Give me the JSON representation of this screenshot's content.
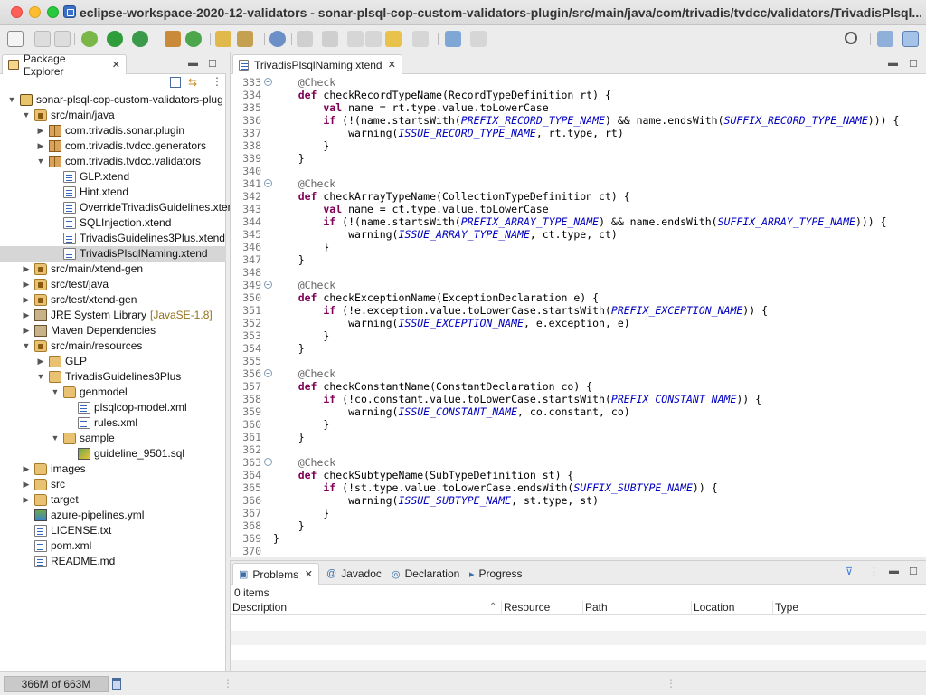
{
  "window": {
    "title": "eclipse-workspace-2020-12-validators - sonar-plsql-cop-custom-validators-plugin/src/main/java/com/trivadis/tvdcc/validators/TrivadisPlsql..."
  },
  "package_explorer": {
    "tab_label": "Package Explorer",
    "tree": [
      {
        "label": "sonar-plsql-cop-custom-validators-plug",
        "depth": 0,
        "arrow": "down",
        "icon": "project"
      },
      {
        "label": "src/main/java",
        "depth": 1,
        "arrow": "down",
        "icon": "source-folder"
      },
      {
        "label": "com.trivadis.sonar.plugin",
        "depth": 2,
        "arrow": "right",
        "icon": "package"
      },
      {
        "label": "com.trivadis.tvdcc.generators",
        "depth": 2,
        "arrow": "right",
        "icon": "package"
      },
      {
        "label": "com.trivadis.tvdcc.validators",
        "depth": 2,
        "arrow": "down",
        "icon": "package"
      },
      {
        "label": "GLP.xtend",
        "depth": 3,
        "arrow": "",
        "icon": "file"
      },
      {
        "label": "Hint.xtend",
        "depth": 3,
        "arrow": "",
        "icon": "file"
      },
      {
        "label": "OverrideTrivadisGuidelines.xtend",
        "depth": 3,
        "arrow": "",
        "icon": "file"
      },
      {
        "label": "SQLInjection.xtend",
        "depth": 3,
        "arrow": "",
        "icon": "file"
      },
      {
        "label": "TrivadisGuidelines3Plus.xtend",
        "depth": 3,
        "arrow": "",
        "icon": "file"
      },
      {
        "label": "TrivadisPlsqlNaming.xtend",
        "depth": 3,
        "arrow": "",
        "icon": "file",
        "selected": true
      },
      {
        "label": "src/main/xtend-gen",
        "depth": 1,
        "arrow": "right",
        "icon": "source-folder"
      },
      {
        "label": "src/test/java",
        "depth": 1,
        "arrow": "right",
        "icon": "source-folder"
      },
      {
        "label": "src/test/xtend-gen",
        "depth": 1,
        "arrow": "right",
        "icon": "source-folder"
      },
      {
        "label": "JRE System Library",
        "decoration": "[JavaSE-1.8]",
        "depth": 1,
        "arrow": "right",
        "icon": "library"
      },
      {
        "label": "Maven Dependencies",
        "depth": 1,
        "arrow": "right",
        "icon": "library"
      },
      {
        "label": "src/main/resources",
        "depth": 1,
        "arrow": "down",
        "icon": "source-folder"
      },
      {
        "label": "GLP",
        "depth": 2,
        "arrow": "right",
        "icon": "folder"
      },
      {
        "label": "TrivadisGuidelines3Plus",
        "depth": 2,
        "arrow": "down",
        "icon": "folder"
      },
      {
        "label": "genmodel",
        "depth": 3,
        "arrow": "down",
        "icon": "folder"
      },
      {
        "label": "plsqlcop-model.xml",
        "depth": 4,
        "arrow": "",
        "icon": "file"
      },
      {
        "label": "rules.xml",
        "depth": 4,
        "arrow": "",
        "icon": "file"
      },
      {
        "label": "sample",
        "depth": 3,
        "arrow": "down",
        "icon": "folder"
      },
      {
        "label": "guideline_9501.sql",
        "depth": 4,
        "arrow": "",
        "icon": "image"
      },
      {
        "label": "images",
        "depth": 1,
        "arrow": "right",
        "icon": "folder"
      },
      {
        "label": "src",
        "depth": 1,
        "arrow": "right",
        "icon": "folder"
      },
      {
        "label": "target",
        "depth": 1,
        "arrow": "right",
        "icon": "folder"
      },
      {
        "label": "azure-pipelines.yml",
        "depth": 1,
        "arrow": "",
        "icon": "yml"
      },
      {
        "label": "LICENSE.txt",
        "depth": 1,
        "arrow": "",
        "icon": "file"
      },
      {
        "label": "pom.xml",
        "depth": 1,
        "arrow": "",
        "icon": "file"
      },
      {
        "label": "README.md",
        "depth": 1,
        "arrow": "",
        "icon": "file"
      }
    ]
  },
  "editor": {
    "tab_label": "TrivadisPlsqlNaming.xtend",
    "lines": [
      {
        "n": "333",
        "fold": true,
        "tokens": [
          [
            "an",
            "    @Check"
          ]
        ]
      },
      {
        "n": "334",
        "tokens": [
          [
            "kw",
            "    def "
          ],
          [
            "",
            "checkRecordTypeName(RecordTypeDefinition rt) {"
          ]
        ]
      },
      {
        "n": "335",
        "tokens": [
          [
            "kw",
            "        val "
          ],
          [
            "",
            "name = rt.type.value.toLowerCase"
          ]
        ]
      },
      {
        "n": "336",
        "tokens": [
          [
            "kw",
            "        if "
          ],
          [
            "",
            "(!(name.startsWith("
          ],
          [
            "cn",
            "PREFIX_RECORD_TYPE_NAME"
          ],
          [
            "",
            ") && name.endsWith("
          ],
          [
            "cn",
            "SUFFIX_RECORD_TYPE_NAME"
          ],
          [
            "",
            "))) {"
          ]
        ]
      },
      {
        "n": "337",
        "tokens": [
          [
            "",
            "            warning("
          ],
          [
            "cn",
            "ISSUE_RECORD_TYPE_NAME"
          ],
          [
            "",
            ", rt.type, rt)"
          ]
        ]
      },
      {
        "n": "338",
        "tokens": [
          [
            "",
            "        }"
          ]
        ]
      },
      {
        "n": "339",
        "tokens": [
          [
            "",
            "    }"
          ]
        ]
      },
      {
        "n": "340",
        "tokens": []
      },
      {
        "n": "341",
        "fold": true,
        "tokens": [
          [
            "an",
            "    @Check"
          ]
        ]
      },
      {
        "n": "342",
        "tokens": [
          [
            "kw",
            "    def "
          ],
          [
            "",
            "checkArrayTypeName(CollectionTypeDefinition ct) {"
          ]
        ]
      },
      {
        "n": "343",
        "tokens": [
          [
            "kw",
            "        val "
          ],
          [
            "",
            "name = ct.type.value.toLowerCase"
          ]
        ]
      },
      {
        "n": "344",
        "tokens": [
          [
            "kw",
            "        if "
          ],
          [
            "",
            "(!(name.startsWith("
          ],
          [
            "cn",
            "PREFIX_ARRAY_TYPE_NAME"
          ],
          [
            "",
            ") && name.endsWith("
          ],
          [
            "cn",
            "SUFFIX_ARRAY_TYPE_NAME"
          ],
          [
            "",
            "))) {"
          ]
        ]
      },
      {
        "n": "345",
        "tokens": [
          [
            "",
            "            warning("
          ],
          [
            "cn",
            "ISSUE_ARRAY_TYPE_NAME"
          ],
          [
            "",
            ", ct.type, ct)"
          ]
        ]
      },
      {
        "n": "346",
        "tokens": [
          [
            "",
            "        }"
          ]
        ]
      },
      {
        "n": "347",
        "tokens": [
          [
            "",
            "    }"
          ]
        ]
      },
      {
        "n": "348",
        "tokens": []
      },
      {
        "n": "349",
        "fold": true,
        "tokens": [
          [
            "an",
            "    @Check"
          ]
        ]
      },
      {
        "n": "350",
        "tokens": [
          [
            "kw",
            "    def "
          ],
          [
            "",
            "checkExceptionName(ExceptionDeclaration e) {"
          ]
        ]
      },
      {
        "n": "351",
        "tokens": [
          [
            "kw",
            "        if "
          ],
          [
            "",
            "(!e.exception.value.toLowerCase.startsWith("
          ],
          [
            "cn",
            "PREFIX_EXCEPTION_NAME"
          ],
          [
            "",
            ")) {"
          ]
        ]
      },
      {
        "n": "352",
        "tokens": [
          [
            "",
            "            warning("
          ],
          [
            "cn",
            "ISSUE_EXCEPTION_NAME"
          ],
          [
            "",
            ", e.exception, e)"
          ]
        ]
      },
      {
        "n": "353",
        "tokens": [
          [
            "",
            "        }"
          ]
        ]
      },
      {
        "n": "354",
        "tokens": [
          [
            "",
            "    }"
          ]
        ]
      },
      {
        "n": "355",
        "tokens": []
      },
      {
        "n": "356",
        "fold": true,
        "tokens": [
          [
            "an",
            "    @Check"
          ]
        ]
      },
      {
        "n": "357",
        "tokens": [
          [
            "kw",
            "    def "
          ],
          [
            "",
            "checkConstantName(ConstantDeclaration co) {"
          ]
        ]
      },
      {
        "n": "358",
        "tokens": [
          [
            "kw",
            "        if "
          ],
          [
            "",
            "(!co.constant.value.toLowerCase.startsWith("
          ],
          [
            "cn",
            "PREFIX_CONSTANT_NAME"
          ],
          [
            "",
            ")) {"
          ]
        ]
      },
      {
        "n": "359",
        "tokens": [
          [
            "",
            "            warning("
          ],
          [
            "cn",
            "ISSUE_CONSTANT_NAME"
          ],
          [
            "",
            ", co.constant, co)"
          ]
        ]
      },
      {
        "n": "360",
        "tokens": [
          [
            "",
            "        }"
          ]
        ]
      },
      {
        "n": "361",
        "tokens": [
          [
            "",
            "    }"
          ]
        ]
      },
      {
        "n": "362",
        "tokens": []
      },
      {
        "n": "363",
        "fold": true,
        "tokens": [
          [
            "an",
            "    @Check"
          ]
        ]
      },
      {
        "n": "364",
        "tokens": [
          [
            "kw",
            "    def "
          ],
          [
            "",
            "checkSubtypeName(SubTypeDefinition st) {"
          ]
        ]
      },
      {
        "n": "365",
        "tokens": [
          [
            "kw",
            "        if "
          ],
          [
            "",
            "(!st.type.value.toLowerCase.endsWith("
          ],
          [
            "cn",
            "SUFFIX_SUBTYPE_NAME"
          ],
          [
            "",
            ")) {"
          ]
        ]
      },
      {
        "n": "366",
        "tokens": [
          [
            "",
            "            warning("
          ],
          [
            "cn",
            "ISSUE_SUBTYPE_NAME"
          ],
          [
            "",
            ", st.type, st)"
          ]
        ]
      },
      {
        "n": "367",
        "tokens": [
          [
            "",
            "        }"
          ]
        ]
      },
      {
        "n": "368",
        "tokens": [
          [
            "",
            "    }"
          ]
        ]
      },
      {
        "n": "369",
        "tokens": [
          [
            "",
            "}"
          ]
        ]
      },
      {
        "n": "370",
        "tokens": []
      }
    ]
  },
  "bottom_panel": {
    "tabs": [
      {
        "label": "Problems",
        "icon": "problems-icon",
        "active": true
      },
      {
        "label": "Javadoc",
        "icon": "javadoc-icon"
      },
      {
        "label": "Declaration",
        "icon": "declaration-icon"
      },
      {
        "label": "Progress",
        "icon": "progress-icon"
      }
    ],
    "items_count": "0 items",
    "columns": [
      "Description",
      "Resource",
      "Path",
      "Location",
      "Type"
    ]
  },
  "status": {
    "heap": "366M of 663M"
  },
  "colors": {
    "keyword": "#7f0055",
    "constant": "#0000c0",
    "annotation": "#646464",
    "selection": "#d6d6d6"
  }
}
